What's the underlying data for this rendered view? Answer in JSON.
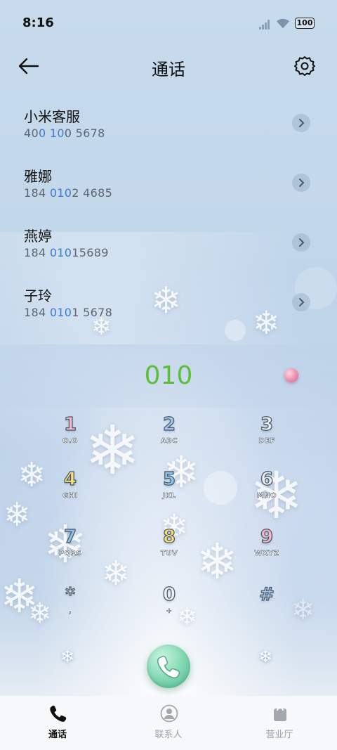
{
  "status_bar": {
    "time": "8:16",
    "battery": "100"
  },
  "header": {
    "title": "通话"
  },
  "contacts": [
    {
      "name": "小米客服",
      "number_pre": "40",
      "number_hl": "0 10",
      "number_post": "0 5678"
    },
    {
      "name": "雅娜",
      "number_pre": "184 ",
      "number_hl": "010",
      "number_post": "2 4685"
    },
    {
      "name": "燕婷",
      "number_pre": "184 ",
      "number_hl": "010",
      "number_post": "15689"
    },
    {
      "name": "子玲",
      "number_pre": "184 ",
      "number_hl": "010",
      "number_post": "1 5678"
    }
  ],
  "dialer": {
    "input": "010"
  },
  "keypad": {
    "keys": [
      {
        "digit": "1",
        "letters": "O.O",
        "color": "#f4b8cf"
      },
      {
        "digit": "2",
        "letters": "ABC",
        "color": "#9fc7ee"
      },
      {
        "digit": "3",
        "letters": "DEF",
        "color": "#e8eef5"
      },
      {
        "digit": "4",
        "letters": "GHI",
        "color": "#f6e07c"
      },
      {
        "digit": "5",
        "letters": "JKL",
        "color": "#86c7ee"
      },
      {
        "digit": "6",
        "letters": "MNO",
        "color": "#e9eef4"
      },
      {
        "digit": "7",
        "letters": "PQRS",
        "color": "#8bc1ec"
      },
      {
        "digit": "8",
        "letters": "TUV",
        "color": "#f4dc79"
      },
      {
        "digit": "9",
        "letters": "WXYZ",
        "color": "#f2b6cd"
      },
      {
        "digit": "*",
        "letters": ",",
        "color": "#eef2f6"
      },
      {
        "digit": "0",
        "letters": "+",
        "color": "#eef2f6"
      },
      {
        "digit": "#",
        "letters": "",
        "color": "#9fc7ee"
      }
    ]
  },
  "bottom_nav": {
    "items": [
      {
        "label": "通话",
        "icon": "phone-icon",
        "active": true
      },
      {
        "label": "联系人",
        "icon": "person-icon",
        "active": false
      },
      {
        "label": "营业厅",
        "icon": "bag-icon",
        "active": false
      }
    ]
  },
  "icons": {
    "back": "arrow-left-icon",
    "settings": "gear-icon",
    "call": "phone-icon",
    "decor": "snowflake-icon"
  },
  "colors": {
    "highlight": "#3d7bd6",
    "dial_text": "#5bbf3a",
    "call_button": "#7fd6b0"
  }
}
